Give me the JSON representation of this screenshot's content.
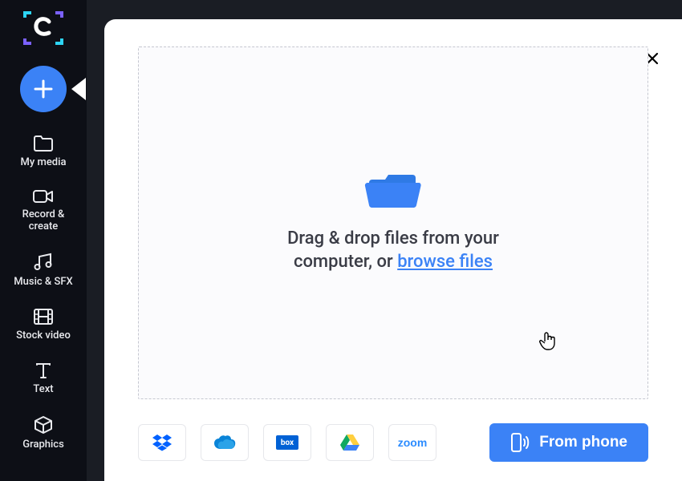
{
  "sidebar": {
    "items": [
      {
        "label": "My media"
      },
      {
        "label": "Record &\ncreate"
      },
      {
        "label": "Music & SFX"
      },
      {
        "label": "Stock video"
      },
      {
        "label": "Text"
      },
      {
        "label": "Graphics"
      }
    ]
  },
  "uploadModal": {
    "dropzoneTextPrefix": "Drag & drop files from your\ncomputer, or ",
    "browseLinkLabel": "browse files",
    "fromPhoneLabel": "From phone",
    "integrations": {
      "dropbox": "Dropbox",
      "onedrive": "OneDrive",
      "box": "box",
      "googledrive": "Google Drive",
      "zoom": "zoom"
    }
  },
  "colors": {
    "accent": "#3b82f6",
    "sidebarBg": "#0d0f16",
    "appBg": "#1a1d24"
  }
}
